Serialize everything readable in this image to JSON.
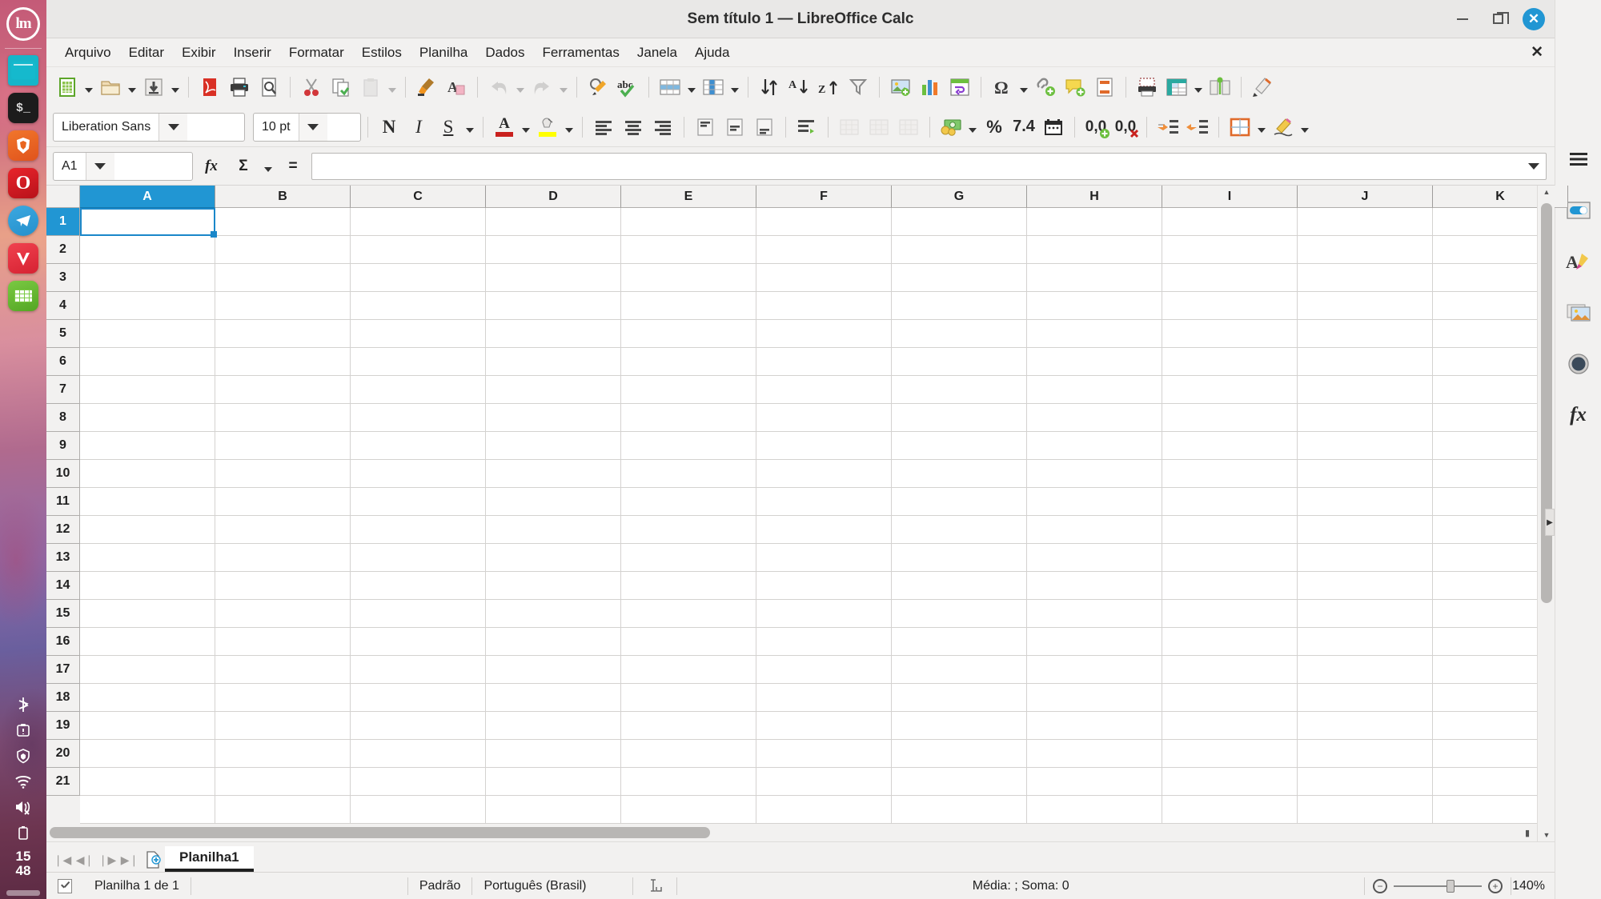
{
  "window": {
    "title": "Sem título 1 — LibreOffice Calc",
    "minimize_label": "",
    "maximize_label": "",
    "close_label": "✕",
    "doc_close_label": "✕"
  },
  "dock": {
    "logo_label": "lm",
    "items": [
      {
        "name": "files",
        "label": ""
      },
      {
        "name": "terminal",
        "label": "$_"
      },
      {
        "name": "brave-browser",
        "label": ""
      },
      {
        "name": "opera-browser",
        "label": "O"
      },
      {
        "name": "telegram",
        "label": "➤"
      },
      {
        "name": "vivaldi-browser",
        "label": "V"
      },
      {
        "name": "libreoffice-calc",
        "label": ""
      }
    ],
    "tray": [
      {
        "name": "bluetooth-icon",
        "glyph": "ᛦ"
      },
      {
        "name": "update-manager-icon",
        "glyph": "❗"
      },
      {
        "name": "firewall-shield-icon",
        "glyph": "⛨"
      },
      {
        "name": "wifi-icon",
        "glyph": "◠"
      },
      {
        "name": "volume-muted-icon",
        "glyph": "▶"
      },
      {
        "name": "battery-icon",
        "glyph": "▯"
      }
    ],
    "clock": {
      "hours": "15",
      "minutes": "48"
    }
  },
  "menubar": {
    "items": [
      "Arquivo",
      "Editar",
      "Exibir",
      "Inserir",
      "Formatar",
      "Estilos",
      "Planilha",
      "Dados",
      "Ferramentas",
      "Janela",
      "Ajuda"
    ]
  },
  "standard_toolbar": {
    "buttons": [
      {
        "name": "new-document-button",
        "tip": "Novo"
      },
      {
        "name": "new-document-dropdown",
        "tip": ""
      },
      {
        "name": "open-file-button",
        "tip": "Abrir"
      },
      {
        "name": "open-file-dropdown",
        "tip": ""
      },
      {
        "name": "save-button",
        "tip": "Salvar"
      },
      {
        "name": "save-dropdown",
        "tip": ""
      },
      {
        "name": "export-pdf-button",
        "tip": "Exportar como PDF"
      },
      {
        "name": "print-button",
        "tip": "Imprimir"
      },
      {
        "name": "print-preview-button",
        "tip": "Visualizar impressão"
      },
      {
        "name": "cut-button",
        "tip": "Cortar"
      },
      {
        "name": "copy-button",
        "tip": "Copiar"
      },
      {
        "name": "paste-button",
        "tip": "Colar"
      },
      {
        "name": "paste-dropdown",
        "tip": ""
      },
      {
        "name": "clone-formatting-button",
        "tip": "Clonar formatação"
      },
      {
        "name": "clear-formatting-button",
        "tip": "Limpar formatação direta"
      },
      {
        "name": "undo-button",
        "tip": "Desfazer"
      },
      {
        "name": "undo-dropdown",
        "tip": ""
      },
      {
        "name": "redo-button",
        "tip": "Refazer"
      },
      {
        "name": "redo-dropdown",
        "tip": ""
      },
      {
        "name": "find-replace-button",
        "tip": "Localizar e substituir"
      },
      {
        "name": "spelling-button",
        "tip": "Verificação ortográfica"
      },
      {
        "name": "row-button",
        "tip": "Linha"
      },
      {
        "name": "row-dropdown",
        "tip": ""
      },
      {
        "name": "column-button",
        "tip": "Coluna"
      },
      {
        "name": "column-dropdown",
        "tip": ""
      },
      {
        "name": "sort-button",
        "tip": "Ordenar"
      },
      {
        "name": "sort-ascending-button",
        "tip": "Ordem crescente"
      },
      {
        "name": "sort-descending-button",
        "tip": "Ordem decrescente"
      },
      {
        "name": "autofilter-button",
        "tip": "Autofiltro"
      },
      {
        "name": "insert-image-button",
        "tip": "Inserir imagem"
      },
      {
        "name": "insert-chart-button",
        "tip": "Inserir gráfico"
      },
      {
        "name": "pivot-table-button",
        "tip": "Tabela dinâmica"
      },
      {
        "name": "special-character-button",
        "tip": "Caractere especial"
      },
      {
        "name": "special-character-dropdown",
        "tip": ""
      },
      {
        "name": "hyperlink-button",
        "tip": "Inserir hiperlink"
      },
      {
        "name": "comment-button",
        "tip": "Inserir comentário"
      },
      {
        "name": "header-footer-button",
        "tip": "Cabeçalhos e rodapés"
      },
      {
        "name": "print-area-button",
        "tip": "Definir área de impressão"
      },
      {
        "name": "freeze-rows-columns-button",
        "tip": "Congelar linhas e colunas"
      },
      {
        "name": "freeze-dropdown",
        "tip": ""
      },
      {
        "name": "split-window-button",
        "tip": "Dividir janela"
      },
      {
        "name": "draw-functions-button",
        "tip": "Mostrar funções de desenho"
      }
    ]
  },
  "formatting_toolbar": {
    "font_name": "Liberation Sans",
    "font_size": "10 pt",
    "bold_label": "N",
    "italic_label": "I",
    "underline_label": "S",
    "font_color_label": "A",
    "percent_label": "%",
    "number_format_label": "7.4",
    "add_decimal_label": "0,0",
    "delete_decimal_label": "0,0"
  },
  "formula_bar": {
    "name_box_value": "A1",
    "function_wizard_label": "fx",
    "sum_label": "Σ",
    "formula_label": "=",
    "input_value": ""
  },
  "grid": {
    "columns": [
      "A",
      "B",
      "C",
      "D",
      "E",
      "F",
      "G",
      "H",
      "I",
      "J",
      "K"
    ],
    "rows": [
      "1",
      "2",
      "3",
      "4",
      "5",
      "6",
      "7",
      "8",
      "9",
      "10",
      "11",
      "12",
      "13",
      "14",
      "15",
      "16",
      "17",
      "18",
      "19",
      "20",
      "21"
    ],
    "selected_cell": "A1",
    "selected_column": "A",
    "selected_row": "1"
  },
  "sheet_bar": {
    "first_sheet_label": "❘◀",
    "prev_sheet_label": "◀❘",
    "next_sheet_label": "❘▶",
    "last_sheet_label": "▶❘",
    "add_sheet_label": "+",
    "tabs": [
      {
        "label": "Planilha1",
        "active": true
      }
    ]
  },
  "status_bar": {
    "sheet_info": "Planilha 1 de 1",
    "page_style": "Padrão",
    "language": "Português (Brasil)",
    "insert_mode": "",
    "selection_summary": "Média: ; Soma: 0",
    "zoom_out_label": "−",
    "zoom_in_label": "+",
    "zoom_percent": "140%"
  },
  "sidebar": {
    "items": [
      {
        "name": "sidebar-settings-menu",
        "label": "≡"
      },
      {
        "name": "sidebar-properties",
        "label": ""
      },
      {
        "name": "sidebar-styles",
        "label": "A"
      },
      {
        "name": "sidebar-gallery",
        "label": ""
      },
      {
        "name": "sidebar-navigator",
        "label": ""
      },
      {
        "name": "sidebar-functions",
        "label": "fx"
      }
    ],
    "expander_label": "▶"
  },
  "colors": {
    "accent": "#2196d3",
    "toolbar_bg": "#f2f1f0",
    "grid_line": "#d4d2d0",
    "header_bg": "#f2f1f0",
    "font_color_swatch": "#c9211e",
    "highlight_swatch": "#ffff00"
  }
}
